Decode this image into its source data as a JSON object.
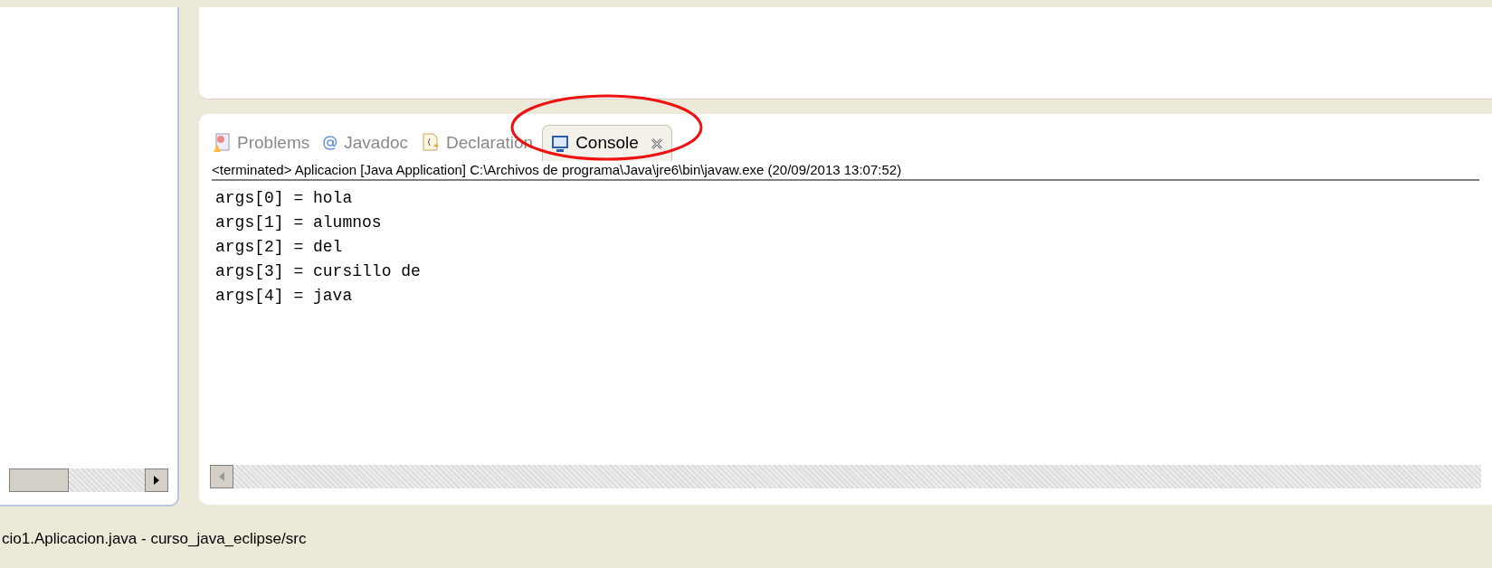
{
  "tabs": [
    {
      "label": "Problems",
      "kind": "problems",
      "selected": false,
      "closable": false
    },
    {
      "label": "Javadoc",
      "kind": "javadoc",
      "selected": false,
      "closable": false
    },
    {
      "label": "Declaration",
      "kind": "declaration",
      "selected": false,
      "closable": false
    },
    {
      "label": "Console",
      "kind": "console",
      "selected": true,
      "closable": true
    }
  ],
  "console": {
    "header": "<terminated> Aplicacion [Java Application] C:\\Archivos de programa\\Java\\jre6\\bin\\javaw.exe (20/09/2013 13:07:52)",
    "lines": [
      "args[0] = hola",
      "args[1] = alumnos",
      "args[2] = del",
      "args[3] = cursillo de",
      "args[4] = java"
    ]
  },
  "status_bar": {
    "text": "cio1.Aplicacion.java - curso_java_eclipse/src"
  }
}
